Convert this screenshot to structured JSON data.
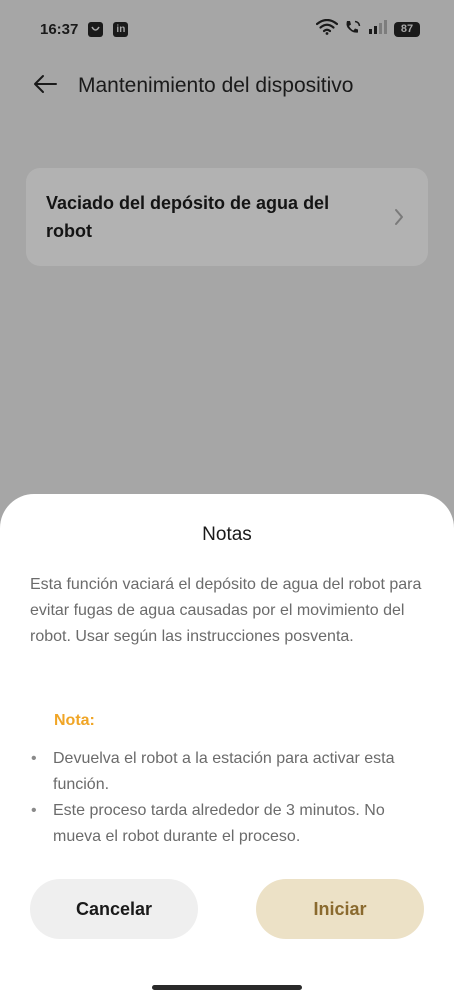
{
  "status_bar": {
    "time": "16:37",
    "notification_icons": [
      "chat-icon",
      "linkedin-icon"
    ],
    "linkedin_glyph": "in",
    "system_icons": [
      "wifi-icon",
      "wifi-calling-icon",
      "signal-icon"
    ],
    "battery": "87"
  },
  "header": {
    "back_icon": "arrow-left-icon",
    "title": "Mantenimiento del dispositivo"
  },
  "settings": {
    "item_label": "Vaciado del depósito de agua del robot",
    "item_icon": "chevron-right-icon"
  },
  "dialog": {
    "title": "Notas",
    "body": "Esta función vaciará el depósito de agua del robot para evitar fugas de agua causadas por el movimiento del robot. Usar según las instrucciones posventa.",
    "note_label": "Nota:",
    "notes": [
      "Devuelva el robot a la estación para activar esta función.",
      "Este proceso tarda alrededor de 3 minutos. No mueva el robot durante el proceso."
    ],
    "cancel_label": "Cancelar",
    "start_label": "Iniciar"
  },
  "colors": {
    "scrim": "#a6a6a6",
    "sheet": "#ffffff",
    "note_accent": "#f0a526",
    "start_button_bg": "#ece1c6",
    "start_button_text": "#8a6a2e",
    "cancel_button_bg": "#efefef"
  }
}
